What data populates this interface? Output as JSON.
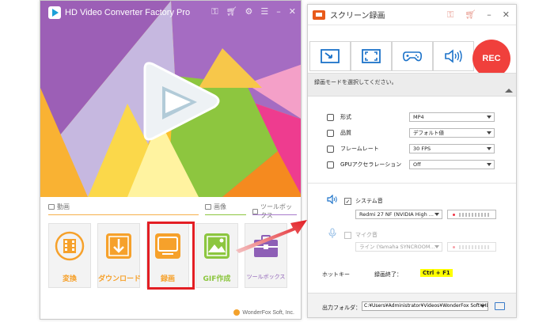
{
  "left_window": {
    "title": "HD Video Converter Factory Pro",
    "sections": {
      "video": "動画",
      "image": "画像",
      "toolbox": "ツールボックス"
    },
    "tiles": [
      {
        "label": "変換",
        "color": "#f6a12b"
      },
      {
        "label": "ダウンロード",
        "color": "#f6a12b"
      },
      {
        "label": "録画",
        "color": "#f6a12b"
      },
      {
        "label": "GIF作成",
        "color": "#8cc63f"
      },
      {
        "label": "ツールボックス",
        "color": "#8e5fb6"
      }
    ],
    "footer": "WonderFox Soft, Inc."
  },
  "right_window": {
    "title": "スクリーン録画",
    "rec_label": "REC",
    "mode_hint": "録画モードを選択してください。",
    "settings": {
      "format_label": "形式",
      "format_value": "MP4",
      "quality_label": "品質",
      "quality_value": "デフォルト値",
      "framerate_label": "フレームレート",
      "framerate_value": "30 FPS",
      "gpu_label": "GPUアクセラレーション",
      "gpu_value": "Off"
    },
    "audio": {
      "system_label": "システム音",
      "system_device": "Redmi 27 NF (NVIDIA High ...",
      "mic_label": "マイク音",
      "mic_device": "ライン (Yamaha SYNCROOM..."
    },
    "hotkey": {
      "label": "ホットキー",
      "stop_label": "録画終了：",
      "key": "Ctrl + F1"
    },
    "output": {
      "label": "出力フォルダ：",
      "path": "C:¥Users¥Administrator¥Videos¥WonderFox Soft¥HD V"
    }
  }
}
